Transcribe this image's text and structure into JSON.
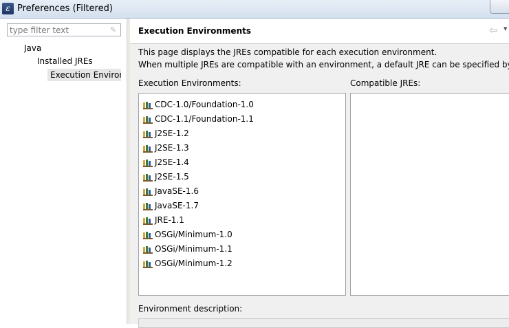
{
  "window": {
    "title": "Preferences (Filtered)",
    "icon": "eclipse-icon"
  },
  "sidebar": {
    "filter_placeholder": "type filter text",
    "filter_value": "",
    "tree": [
      {
        "label": "Java",
        "level": 0
      },
      {
        "label": "Installed JREs",
        "level": 1
      },
      {
        "label": "Execution Environments",
        "level": 2,
        "selected": true
      }
    ]
  },
  "page": {
    "title": "Execution Environments",
    "description_line1": "This page displays the JREs compatible for each execution environment.",
    "description_line2": "When multiple JREs are compatible with an environment, a default JRE can be specified by ch",
    "ee_label": "Execution Environments:",
    "jres_label": "Compatible JREs:",
    "env_desc_label": "Environment description:",
    "environments": [
      "CDC-1.0/Foundation-1.0",
      "CDC-1.1/Foundation-1.1",
      "J2SE-1.2",
      "J2SE-1.3",
      "J2SE-1.4",
      "J2SE-1.5",
      "JavaSE-1.6",
      "JavaSE-1.7",
      "JRE-1.1",
      "OSGi/Minimum-1.0",
      "OSGi/Minimum-1.1",
      "OSGi/Minimum-1.2"
    ],
    "compatible_jres": []
  },
  "icons": {
    "back": "back-arrow-icon",
    "forward": "forward-dropdown-icon",
    "environment": "jre-library-icon"
  }
}
